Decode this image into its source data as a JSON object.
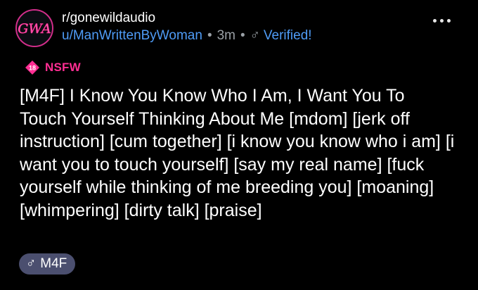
{
  "post": {
    "subreddit": "r/gonewildaudio",
    "avatar_text": "GWA",
    "author": "u/ManWrittenByWoman",
    "separator": "•",
    "time": "3m",
    "flair_icon": "♂",
    "flair_label": "Verified!",
    "nsfw_badge": "18",
    "nsfw_label": "NSFW",
    "title": "[M4F] I Know You Know Who I Am, I Want You To Touch Yourself Thinking About Me [mdom] [jerk off instruction] [cum together] [i know you know who i am] [i want you to touch yourself] [say my real name] [fuck yourself while thinking of me breeding you] [moaning] [whimpering] [dirty talk] [praise]",
    "tag_icon": "♂",
    "tag_label": "M4F"
  },
  "colors": {
    "background": "#000000",
    "link_blue": "#4f9cf7",
    "nsfw_pink": "#ff2e93",
    "tag_bg": "#4b4f6f",
    "muted": "#9aa0a6"
  },
  "icons": {
    "avatar": "gwa-logo-icon",
    "more": "more-options-icon",
    "nsfw": "nsfw-badge-icon",
    "flair": "male-symbol-icon"
  }
}
